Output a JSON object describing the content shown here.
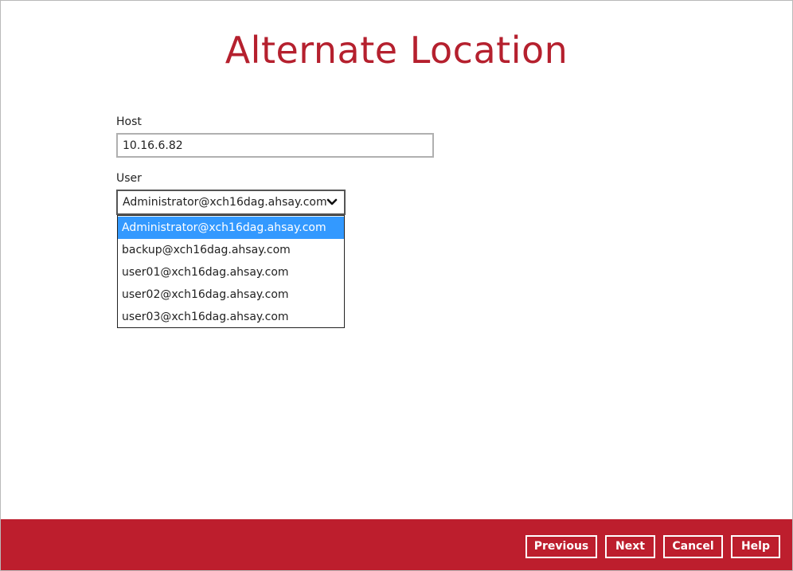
{
  "page": {
    "title": "Alternate Location"
  },
  "form": {
    "host": {
      "label": "Host",
      "value": "10.16.6.82"
    },
    "user": {
      "label": "User",
      "selected": "Administrator@xch16dag.ahsay.com",
      "options": [
        "Administrator@xch16dag.ahsay.com",
        "backup@xch16dag.ahsay.com",
        "user01@xch16dag.ahsay.com",
        "user02@xch16dag.ahsay.com",
        "user03@xch16dag.ahsay.com"
      ],
      "highlighted_index": 0
    }
  },
  "footer": {
    "previous_label": "Previous",
    "next_label": "Next",
    "cancel_label": "Cancel",
    "help_label": "Help"
  },
  "colors": {
    "accent": "#bd1e2d",
    "title": "#b5202e",
    "highlight": "#3399ff"
  },
  "icons": {
    "dropdown": "chevron-down-icon"
  }
}
